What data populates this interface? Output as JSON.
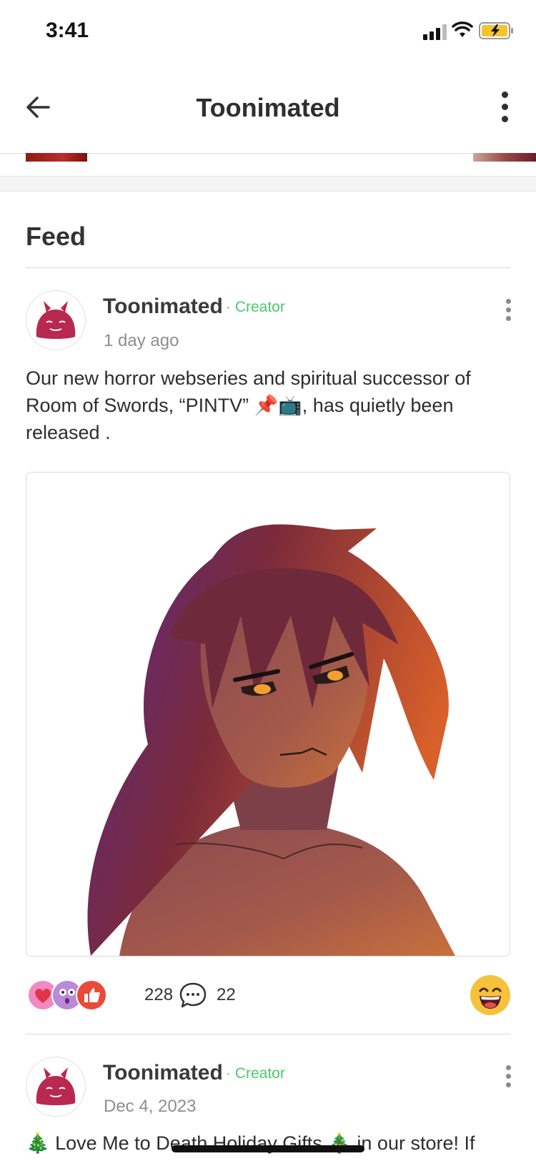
{
  "status_bar": {
    "time": "3:41",
    "icons": [
      "signal-icon",
      "wifi-icon",
      "battery-charging-icon"
    ]
  },
  "nav": {
    "title": "Toonimated",
    "back_icon": "back-arrow-icon",
    "more_icon": "more-vertical-icon"
  },
  "feed": {
    "heading": "Feed",
    "posts": [
      {
        "author": "Toonimated",
        "badge": "· Creator",
        "time": "1 day ago",
        "text": "Our new horror webseries and spiritual successor of Room of Swords, “PINTV” 📌📺, has quietly been released .",
        "reaction_icons": [
          "heart-reaction-icon",
          "surprised-reaction-icon",
          "thumbs-up-reaction-icon"
        ],
        "reaction_count": "228",
        "comment_count": "22",
        "emoji_icon": "laughing-emoji-icon"
      },
      {
        "author": "Toonimated",
        "badge": "· Creator",
        "time": "Dec 4, 2023",
        "text": "🎄 Love Me to Death Holiday Gifts 🎄 in our store! If"
      }
    ]
  },
  "colors": {
    "accent_green": "#4cc96a",
    "avatar_blob": "#b8294f",
    "heart_red": "#e0344a"
  }
}
